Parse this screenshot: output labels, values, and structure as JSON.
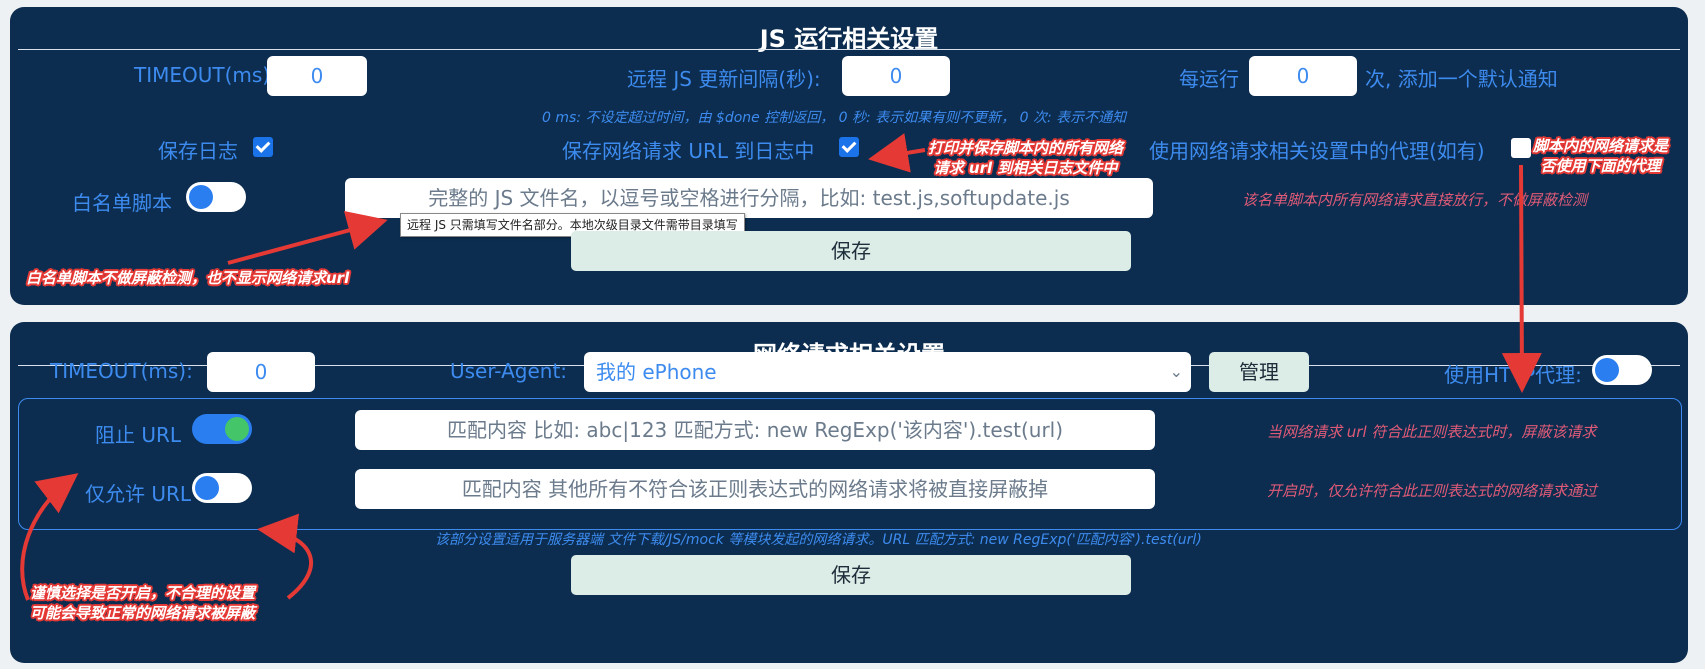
{
  "js_panel": {
    "title": "JS 运行相关设置",
    "timeout_label": "TIMEOUT(ms):",
    "timeout_value": "0",
    "update_interval_label": "远程 JS 更新间隔(秒):",
    "update_interval_value": "0",
    "notify_prefix": "每运行",
    "notify_value": "0",
    "notify_suffix": "次, 添加一个默认通知",
    "hint": "0 ms: 不设定超过时间，由 $done 控制返回，  0 秒: 表示如果有则不更新，  0 次: 表示不通知",
    "save_log_label": "保存日志",
    "save_log_checked": true,
    "save_url_label": "保存网络请求 URL 到日志中",
    "save_url_checked": true,
    "use_proxy_label": "使用网络请求相关设置中的代理(如有)",
    "use_proxy_checked": false,
    "whitelist_label": "白名单脚本",
    "whitelist_enabled": false,
    "whitelist_placeholder": "完整的 JS 文件名，以逗号或空格进行分隔，比如: test.js,softupdate.js",
    "whitelist_tooltip": "远程 JS 只需填写文件名部分。本地次级目录文件需带目录填写",
    "whitelist_hint": "该名单脚本内所有网络请求直接放行，不做屏蔽检测",
    "save_label": "保存"
  },
  "net_panel": {
    "title": "网络请求相关设置",
    "timeout_label": "TIMEOUT(ms):",
    "timeout_value": "0",
    "ua_label": "User-Agent:",
    "ua_selected": "我的 ePhone",
    "manage_label": "管理",
    "http_proxy_label": "使用HTTP代理:",
    "http_proxy_enabled": false,
    "block_url_label": "阻止 URL",
    "block_url_enabled": true,
    "block_url_placeholder": "匹配内容 比如: abc|123 匹配方式: new RegExp('该内容').test(url)",
    "block_url_hint": "当网络请求 url 符合此正则表达式时，屏蔽该请求",
    "allow_url_label": "仅允许 URL",
    "allow_url_enabled": false,
    "allow_url_placeholder": "匹配内容 其他所有不符合该正则表达式的网络请求将被直接屏蔽掉",
    "allow_url_hint": "开启时，仅允许符合此正则表达式的网络请求通过",
    "footer_hint": "该部分设置适用于服务器端 文件下载/JS/mock 等模块发起的网络请求。URL 匹配方式: new RegExp('匹配内容').test(url)",
    "save_label": "保存"
  },
  "annotations": {
    "print_url_line1": "打印并保存脚本内的所有网络",
    "print_url_line2": "请求 url 到相关日志文件中",
    "proxy_line1": "脚本内的网络请求是",
    "proxy_line2": "否使用下面的代理",
    "whitelist_note": "白名单脚本不做屏蔽检测，也不显示网络请求url",
    "caution_line1": "谨慎选择是否开启，不合理的设置",
    "caution_line2": "可能会导致正常的网络请求被屏蔽"
  },
  "colors": {
    "panel_bg": "#0c2d4f",
    "accent_blue": "#3d8bef",
    "hint_pink": "#e05a78",
    "annotation_red": "#e53935",
    "save_button_bg": "#dcece6",
    "toggle_on_green": "#44c56a"
  },
  "icons": {
    "checkbox_checked": "check-icon",
    "select_caret": "chevron-down-icon",
    "annotation_arrow": "arrow-icon"
  }
}
